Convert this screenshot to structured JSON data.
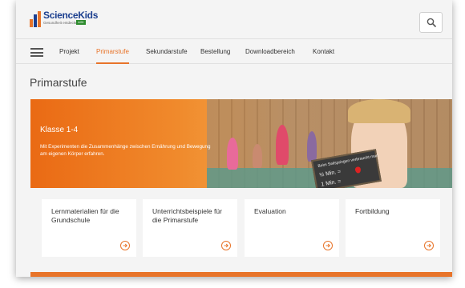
{
  "header": {
    "logo_title": "ScienceKids",
    "logo_subtitle": "Gesundheit entdecken",
    "logo_badge": "AOK",
    "search_icon": "search-icon",
    "logo_colors": [
      "#e8742a",
      "#2e8b2e",
      "#1c3f8f"
    ]
  },
  "nav": {
    "menu_icon": "hamburger-icon",
    "items": [
      {
        "label": "Projekt",
        "active": false
      },
      {
        "label": "Primarstufe",
        "active": true
      },
      {
        "label": "Sekundarstufe",
        "active": false
      },
      {
        "label": "Bestellung",
        "active": false
      },
      {
        "label": "Downloadbereich",
        "active": false
      },
      {
        "label": "Kontakt",
        "active": false
      }
    ]
  },
  "page": {
    "title": "Primarstufe"
  },
  "banner": {
    "heading": "Klasse 1-4",
    "text": "Mit Experimenten die Zusammenhänge zwischen Ernährung und Bewegung am eigenen Körper erfahren.",
    "chalkboard_lines": [
      "Beim Seilspringen verbraucht man",
      "½ Min. =",
      "1 Min. ="
    ]
  },
  "cards": [
    {
      "title": "Lernmaterialien für die Grundschule",
      "icon": "arrow-right-circle-icon"
    },
    {
      "title": "Unterrichtsbeispiele für die Primarstufe",
      "icon": "arrow-right-circle-icon"
    },
    {
      "title": "Evaluation",
      "icon": "arrow-right-circle-icon"
    },
    {
      "title": "Fortbildung",
      "icon": "arrow-right-circle-icon"
    }
  ],
  "colors": {
    "accent": "#e8742a",
    "background": "#f4f4f4",
    "card": "#ffffff"
  }
}
